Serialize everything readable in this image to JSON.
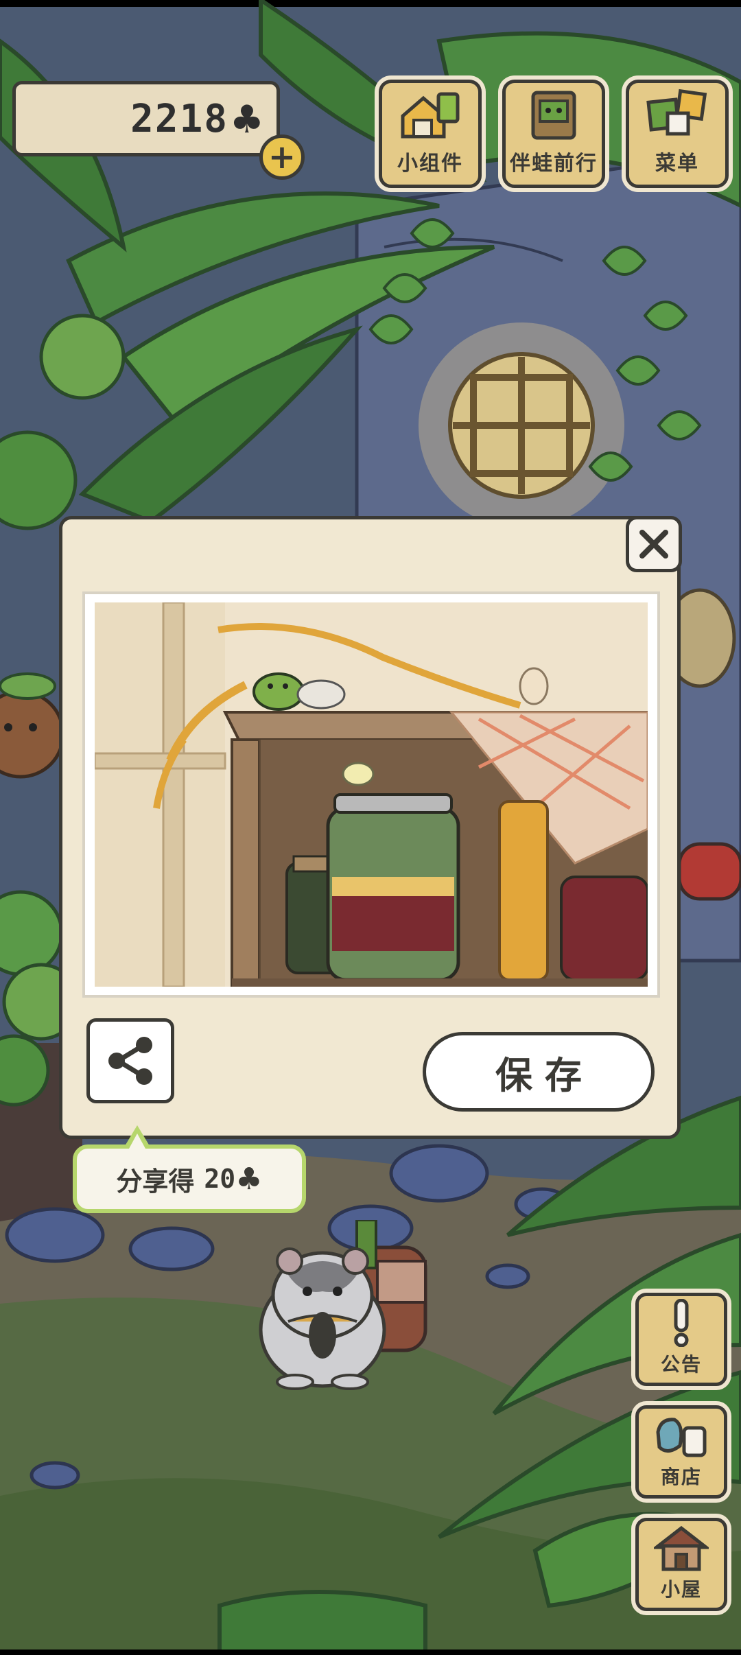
{
  "hud": {
    "clover_count": "2218",
    "clover_symbol": "♣",
    "add_symbol": "+"
  },
  "top_menu": {
    "widgets_label": "小组件",
    "travel_label": "伴蛙前行",
    "menu_label": "菜单"
  },
  "photo_dialog": {
    "close_symbol": "✕",
    "save_label": "保存",
    "share_tip": {
      "text": "分享得",
      "amount": "20",
      "clover_symbol": "♣"
    }
  },
  "side_menu": {
    "notice_label": "公告",
    "shop_label": "商店",
    "house_label": "小屋"
  },
  "colors": {
    "outline": "#3b3a35",
    "panel": "#f1e8d2",
    "wood": "#e4ca88",
    "tip_border": "#b6d66c",
    "coin": "#e9c44e"
  },
  "icons": [
    "clover-icon",
    "plus-icon",
    "widgets-icon",
    "travel-icon",
    "menu-icon",
    "close-icon",
    "share-icon",
    "exclamation-icon",
    "shop-icon",
    "house-icon"
  ]
}
